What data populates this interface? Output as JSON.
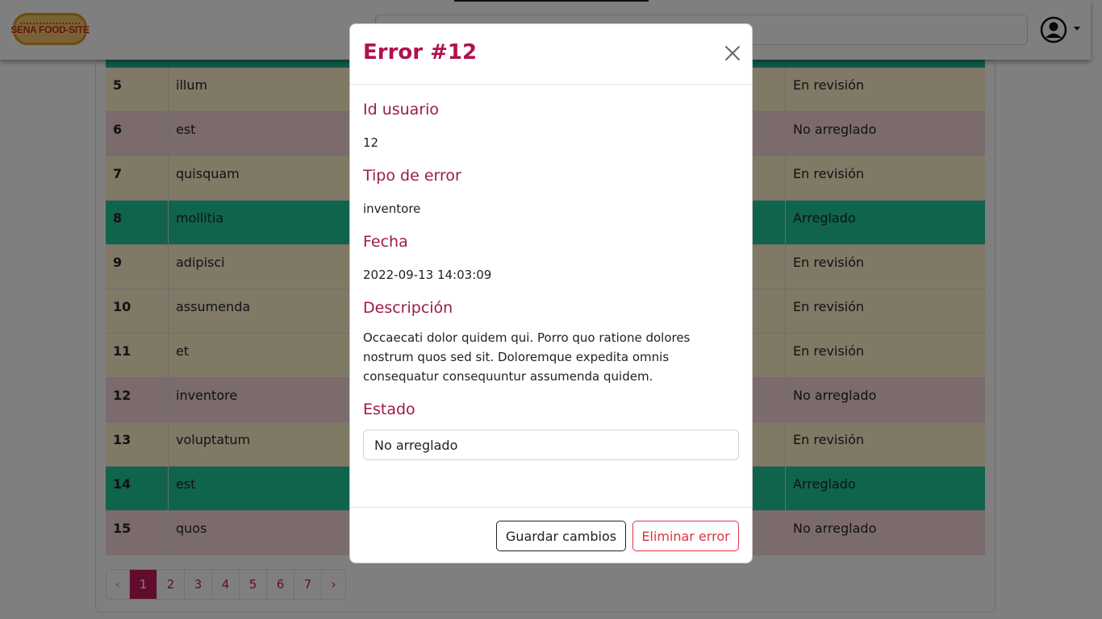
{
  "brand": {
    "logo_text": "SENA FOOD-SITE"
  },
  "header": {
    "search_placeholder": ""
  },
  "table": {
    "rows": [
      {
        "id": "5",
        "tipo": "illum",
        "estado": "En revisión",
        "status": "rev"
      },
      {
        "id": "6",
        "tipo": "est",
        "estado": "No arreglado",
        "status": "no"
      },
      {
        "id": "7",
        "tipo": "quisquam",
        "estado": "En revisión",
        "status": "rev"
      },
      {
        "id": "8",
        "tipo": "mollitia",
        "estado": "Arreglado",
        "status": "ok"
      },
      {
        "id": "9",
        "tipo": "adipisci",
        "estado": "En revisión",
        "status": "rev"
      },
      {
        "id": "10",
        "tipo": "assumenda",
        "estado": "En revisión",
        "status": "rev"
      },
      {
        "id": "11",
        "tipo": "et",
        "estado": "En revisión",
        "status": "rev"
      },
      {
        "id": "12",
        "tipo": "inventore",
        "estado": "No arreglado",
        "status": "no"
      },
      {
        "id": "13",
        "tipo": "voluptatum",
        "estado": "En revisión",
        "status": "rev"
      },
      {
        "id": "14",
        "tipo": "est",
        "estado": "Arreglado",
        "status": "ok"
      },
      {
        "id": "15",
        "tipo": "quos",
        "estado": "No arreglado",
        "status": "no"
      }
    ]
  },
  "pagination": {
    "prev": "‹",
    "next": "›",
    "pages": [
      "1",
      "2",
      "3",
      "4",
      "5",
      "6",
      "7"
    ],
    "active": "1"
  },
  "modal": {
    "title": "Error #12",
    "user_label": "Id usuario",
    "user_value": "12",
    "type_label": "Tipo de error",
    "type_value": "inventore",
    "date_label": "Fecha",
    "date_value": "2022-09-13 14:03:09",
    "desc_label": "Descripción",
    "desc_value": "Occaecati dolor quidem qui. Porro quo ratione dolores nostrum quos sed sit. Doloremque expedita omnis consequatur consequuntur assumenda quidem.",
    "status_label": "Estado",
    "status_value": "No arreglado",
    "save_label": "Guardar cambios",
    "delete_label": "Eliminar error"
  },
  "colors": {
    "accent": "#c2185b",
    "review": "#fff3cd",
    "not_fixed": "#f8d7da",
    "fixed": "#20c997",
    "danger": "#dc3545"
  },
  "icons": {
    "close": "close-icon",
    "user": "user-circle-icon",
    "dropdown": "caret-down-icon"
  }
}
